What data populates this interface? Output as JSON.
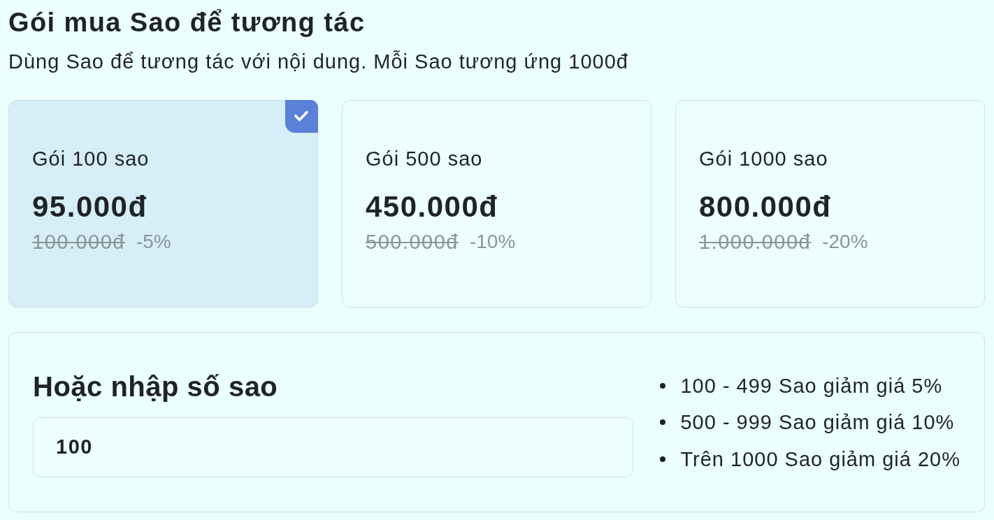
{
  "title": "Gói mua Sao để tương tác",
  "subtitle": "Dùng Sao để tương tác với nội dung. Mỗi Sao tương ứng 1000đ",
  "packages": [
    {
      "name": "Gói 100 sao",
      "price": "95.000đ",
      "original_price": "100.000đ",
      "discount": "-5%",
      "selected": true
    },
    {
      "name": "Gói 500 sao",
      "price": "450.000đ",
      "original_price": "500.000đ",
      "discount": "-10%",
      "selected": false
    },
    {
      "name": "Gói 1000 sao",
      "price": "800.000đ",
      "original_price": "1.000.000đ",
      "discount": "-20%",
      "selected": false
    }
  ],
  "custom_amount": {
    "heading": "Hoặc nhập số sao",
    "input": {
      "value": "100"
    },
    "discount_tiers": [
      "100 - 499 Sao giảm giá 5%",
      "500 - 999 Sao giảm giá 10%",
      "Trên 1000 Sao giảm giá 20%"
    ]
  }
}
